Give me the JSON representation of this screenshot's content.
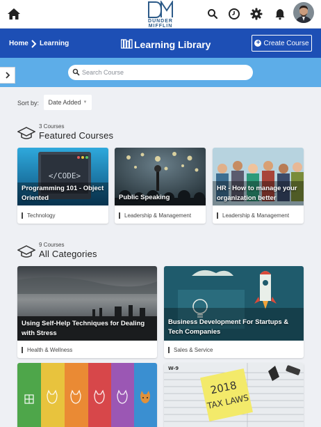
{
  "brand": {
    "line1": "DUNDER",
    "line2": "MIFFLIN"
  },
  "topbar_icons": [
    "home-icon",
    "search-icon",
    "clock-icon",
    "gear-icon",
    "bell-icon"
  ],
  "breadcrumb": {
    "home": "Home",
    "current": "Learning"
  },
  "header": {
    "title": "Learning Library",
    "create_label": "Create Course"
  },
  "search": {
    "placeholder": "Search Course"
  },
  "sort": {
    "label": "Sort by:",
    "value": "Date Added"
  },
  "featured": {
    "count": "3 Courses",
    "title": "Featured Courses",
    "courses": [
      {
        "title": "Programming 101 - Object Oriented",
        "category": "Technology"
      },
      {
        "title": "Public Speaking",
        "category": "Leadership & Management"
      },
      {
        "title": "HR - How to manage your organization better",
        "category": "Leadership & Management"
      }
    ]
  },
  "all": {
    "count": "9 Courses",
    "title": "All Categories",
    "courses": [
      {
        "title": "Using Self-Help Techniques for Dealing with Stress",
        "category": "Health & Wellness"
      },
      {
        "title": "Business Development For Startups & Tech Companies",
        "category": "Sales & Service"
      },
      {
        "title": "",
        "category": ""
      },
      {
        "title": "",
        "category": ""
      }
    ]
  },
  "thumb_texts": {
    "code": "</CODE>",
    "tax_line1": "2018",
    "tax_line2": "TAX LAWS"
  },
  "colors": {
    "header_blue": "#1d4fb5",
    "search_band": "#5dade8",
    "page_bg": "#eef0f4"
  }
}
